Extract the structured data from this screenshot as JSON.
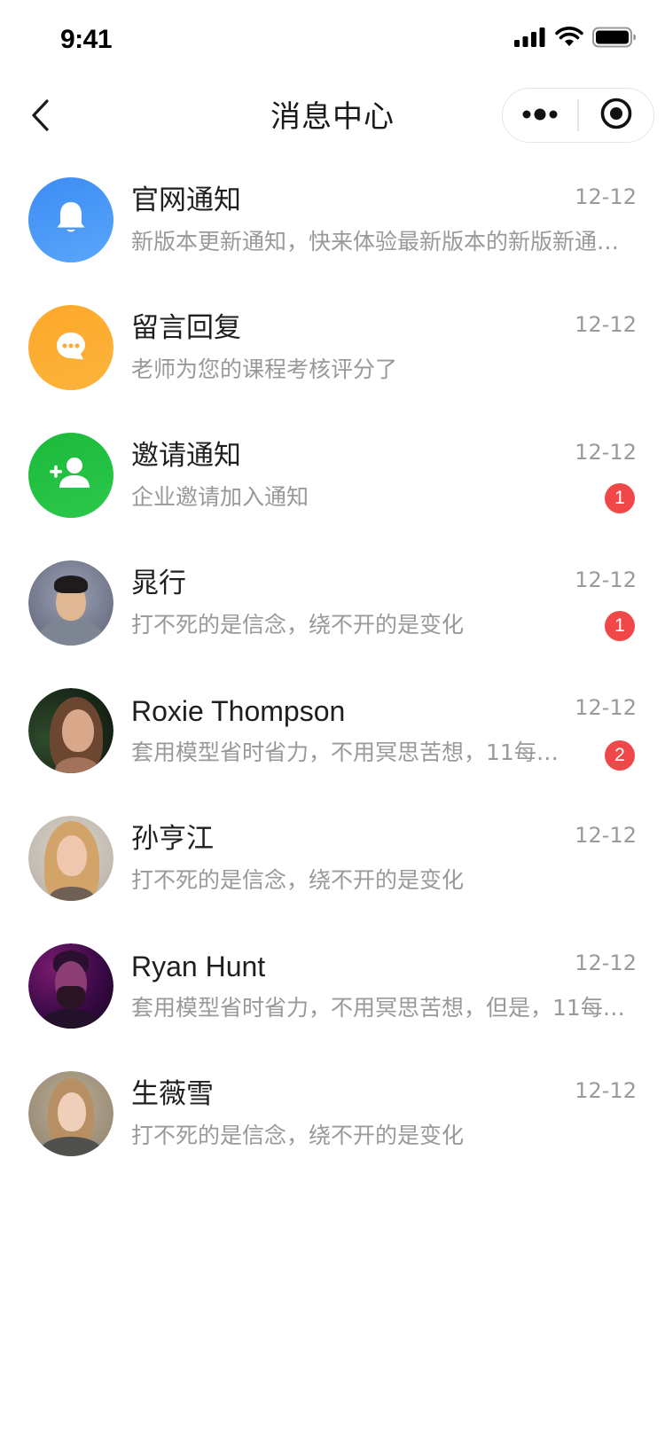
{
  "status_bar": {
    "time": "9:41"
  },
  "nav": {
    "title": "消息中心",
    "back_icon": "chevron-left-icon",
    "more_icon": "more-dots-icon",
    "close_icon": "target-circle-icon"
  },
  "messages": [
    {
      "title": "官网通知",
      "preview": "新版本更新通知，快来体验最新版本的新版新通知功能",
      "time": "12-12",
      "badge": "",
      "avatar_icon": "bell-icon",
      "avatar_color": "#4a90f5"
    },
    {
      "title": "留言回复",
      "preview": "老师为您的课程考核评分了",
      "time": "12-12",
      "badge": "",
      "avatar_icon": "chat-bubble-icon",
      "avatar_color": "#fbb031"
    },
    {
      "title": "邀请通知",
      "preview": "企业邀请加入通知",
      "time": "12-12",
      "badge": "1",
      "avatar_icon": "add-user-icon",
      "avatar_color": "#21c141"
    },
    {
      "title": "晁行",
      "preview": "打不死的是信念，绕不开的是变化",
      "time": "12-12",
      "badge": "1",
      "avatar_icon": "user-photo"
    },
    {
      "title": "Roxie Thompson",
      "preview": "套用模型省时省力，不用冥思苦想，11每…",
      "time": "12-12",
      "badge": "2",
      "avatar_icon": "user-photo"
    },
    {
      "title": "孙亨江",
      "preview": "打不死的是信念，绕不开的是变化",
      "time": "12-12",
      "badge": "",
      "avatar_icon": "user-photo"
    },
    {
      "title": "Ryan Hunt",
      "preview": "套用模型省时省力，不用冥思苦想，但是，11每…",
      "time": "12-12",
      "badge": "",
      "avatar_icon": "user-photo"
    },
    {
      "title": "生薇雪",
      "preview": "打不死的是信念，绕不开的是变化",
      "time": "12-12",
      "badge": "",
      "avatar_icon": "user-photo"
    }
  ]
}
